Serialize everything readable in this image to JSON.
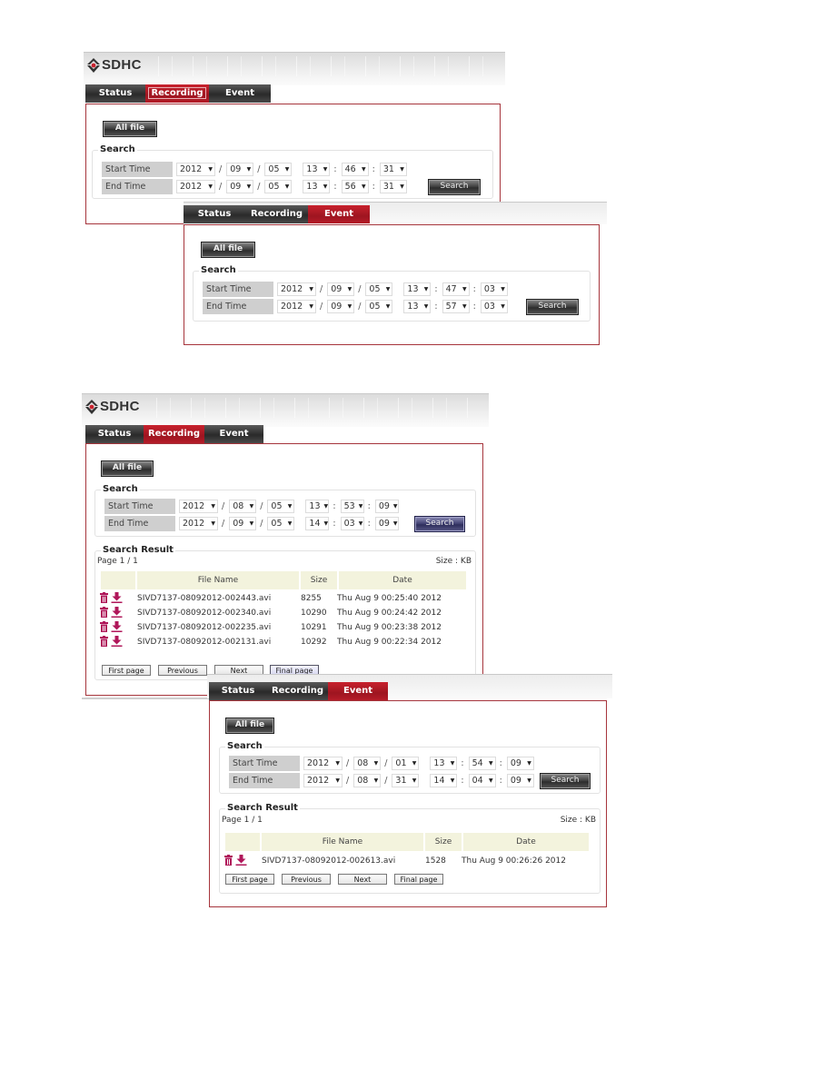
{
  "app": {
    "logo_text": "SDHC"
  },
  "tabs": [
    "Status",
    "Recording",
    "Event"
  ],
  "labels": {
    "all_file": "All file",
    "search_legend": "Search",
    "start_time": "Start Time",
    "end_time": "End Time",
    "search_button": "Search",
    "result_legend": "Search Result",
    "size_unit": "Size : KB",
    "col_file_name": "File Name",
    "col_size": "Size",
    "col_date": "Date",
    "first_page": "First page",
    "previous": "Previous",
    "next": "Next",
    "final_page": "Final page",
    "date_sep": "/",
    "time_sep": ":"
  },
  "colors": {
    "accent_red": "#b51c28",
    "icon_magenta": "#b0175a",
    "border": "#a6353c",
    "header_bg": "#f3f3dd"
  },
  "panels": [
    {
      "active_tab": "Recording",
      "start": {
        "year": "2012",
        "month": "09",
        "day": "05",
        "hour": "13",
        "minute": "46",
        "second": "31"
      },
      "end": {
        "year": "2012",
        "month": "09",
        "day": "05",
        "hour": "13",
        "minute": "56",
        "second": "31"
      }
    },
    {
      "active_tab": "Event",
      "start": {
        "year": "2012",
        "month": "09",
        "day": "05",
        "hour": "13",
        "minute": "47",
        "second": "03"
      },
      "end": {
        "year": "2012",
        "month": "09",
        "day": "05",
        "hour": "13",
        "minute": "57",
        "second": "03"
      }
    },
    {
      "active_tab": "Recording",
      "start": {
        "year": "2012",
        "month": "08",
        "day": "05",
        "hour": "13",
        "minute": "53",
        "second": "09"
      },
      "end": {
        "year": "2012",
        "month": "09",
        "day": "05",
        "hour": "14",
        "minute": "03",
        "second": "09"
      },
      "page_info": "Page 1 / 1",
      "results": [
        {
          "file": "SIVD7137-08092012-002443.avi",
          "size": "8255",
          "date": "Thu Aug 9 00:25:40 2012"
        },
        {
          "file": "SIVD7137-08092012-002340.avi",
          "size": "10290",
          "date": "Thu Aug 9 00:24:42 2012"
        },
        {
          "file": "SIVD7137-08092012-002235.avi",
          "size": "10291",
          "date": "Thu Aug 9 00:23:38 2012"
        },
        {
          "file": "SIVD7137-08092012-002131.avi",
          "size": "10292",
          "date": "Thu Aug 9 00:22:34 2012"
        }
      ]
    },
    {
      "active_tab": "Event",
      "start": {
        "year": "2012",
        "month": "08",
        "day": "01",
        "hour": "13",
        "minute": "54",
        "second": "09"
      },
      "end": {
        "year": "2012",
        "month": "08",
        "day": "31",
        "hour": "14",
        "minute": "04",
        "second": "09"
      },
      "page_info": "Page 1 / 1",
      "results": [
        {
          "file": "SIVD7137-08092012-002613.avi",
          "size": "1528",
          "date": "Thu Aug 9 00:26:26 2012"
        }
      ]
    }
  ]
}
